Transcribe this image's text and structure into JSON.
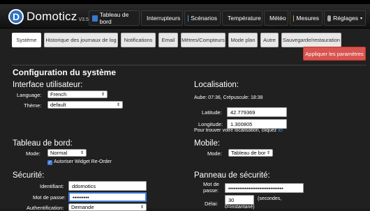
{
  "brand": {
    "name": "Domoticz",
    "version": "V3.5877"
  },
  "nav": [
    {
      "label": "Tableau de bord",
      "icon": "dashboard-icon"
    },
    {
      "label": "Interrupteurs",
      "icon": "bulb-icon"
    },
    {
      "label": "Scénarios",
      "icon": "scenes-icon"
    },
    {
      "label": "Température",
      "icon": "thermometer-icon"
    },
    {
      "label": "Météo",
      "icon": "weather-icon"
    },
    {
      "label": "Mesures",
      "icon": "measure-icon"
    },
    {
      "label": "Réglages",
      "icon": "gear-icon"
    }
  ],
  "tabs": [
    "Système",
    "Historique des journaux de log",
    "Notifications",
    "Email",
    "Mètres/Compteurs",
    "Mode plan",
    "Autre",
    "Sauvegarde/restauration"
  ],
  "apply_button": "Appliquer les paramètres",
  "page_title": "Configuration du système",
  "ui": {
    "title": "Interface utilisateur:",
    "language_label": "Language:",
    "language_value": "French",
    "theme_label": "Thème:",
    "theme_value": "default"
  },
  "location": {
    "title": "Localisation:",
    "sun": "Aube: 07:36, Crépuscule: 18:38",
    "lat_label": "Latitude:",
    "lat_value": "42.779369",
    "lon_label": "Longitude:",
    "lon_value": "1.300805",
    "find_text": "Pour trouver votre localisation, cliquez",
    "find_link": "ici"
  },
  "dashboard": {
    "title": "Tableau de bord:",
    "mode_label": "Mode:",
    "mode_value": "Normal",
    "reorder_label": "Autoriser Widget Re-Order"
  },
  "mobile": {
    "title": "Mobile:",
    "mode_label": "Mode:",
    "mode_value": "Tableau de bor"
  },
  "security": {
    "title": "Sécurité:",
    "id_label": "Identifiant:",
    "id_value": "ddomotics",
    "pwd_label": "Mot de passe:",
    "pwd_value": "•••••••••",
    "auth_label": "Authentification:",
    "auth_value": "Demande"
  },
  "panel": {
    "title": "Panneau de sécurité:",
    "pwd_label_1": "Mot de",
    "pwd_label_2": "passe:",
    "pwd_value": "••••••••••••••••••••••••••••••",
    "delay_label": "Délai:",
    "delay_value": "30",
    "delay_unit_1": "(secondes,",
    "delay_unit_2": "0=instantané)"
  },
  "colors": {
    "apply": "#d9534f",
    "link": "#4aa3ff",
    "logo": "#2e6fc2"
  }
}
